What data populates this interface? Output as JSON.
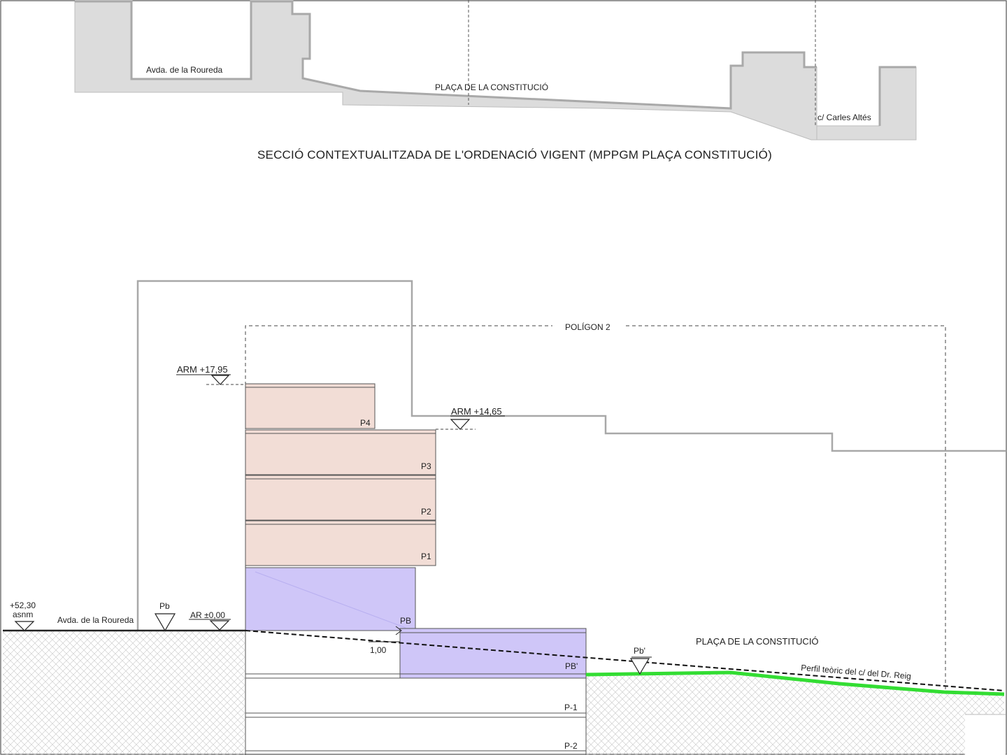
{
  "top_section": {
    "street_left": "Avda. de la Roureda",
    "plaza": "PLAÇA DE LA CONSTITUCIÓ",
    "street_right": "c/ Carles Altés",
    "title": "SECCIÓ CONTEXTUALITZADA DE L'ORDENACIÓ VIGENT (MPPGM PLAÇA CONSTITUCIÓ)"
  },
  "main_section": {
    "polygon": "POLÍGON 2",
    "arm_high": "ARM +17,95",
    "arm_mid": "ARM +14,65",
    "ar_level": "AR ±0,00",
    "pb_mark": "Pb",
    "pb_prime_mark": "Pb'",
    "altitude_value": "+52,30",
    "altitude_unit": "asnm",
    "street_left": "Avda. de la Roureda",
    "plaza": "PLAÇA DE LA CONSTITUCIÓ",
    "profile": "Perfil teòric del c/ del Dr. Reig",
    "step_dimension": "1,00",
    "floors": {
      "p4": "P4",
      "p3": "P3",
      "p2": "P2",
      "p1": "P1",
      "pb": "PB",
      "pb_prime": "PB'",
      "p_minus1": "P-1",
      "p_minus2": "P-2"
    }
  },
  "colors": {
    "upper_floors_fill": "#f2ddd6",
    "ground_floor_fill": "#cfc6f8",
    "terrain_profile": "#33dd33",
    "context_gray": "#dcdcdc"
  }
}
